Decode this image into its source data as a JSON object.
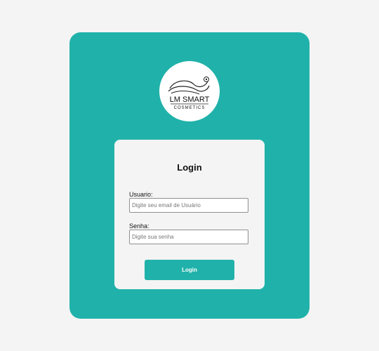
{
  "logo": {
    "brand_top": "LM SMART",
    "brand_bottom": "COSMETICS"
  },
  "login": {
    "title": "Login",
    "username_label": "Usuario:",
    "username_placeholder": "Digite seu email de Usuário",
    "password_label": "Senha:",
    "password_placeholder": "Digite sua senha",
    "submit_label": "Login"
  },
  "colors": {
    "background": "#f4f4f4",
    "accent": "#20b2aa",
    "card": "#f4f4f4",
    "logo_bg": "#ffffff"
  }
}
